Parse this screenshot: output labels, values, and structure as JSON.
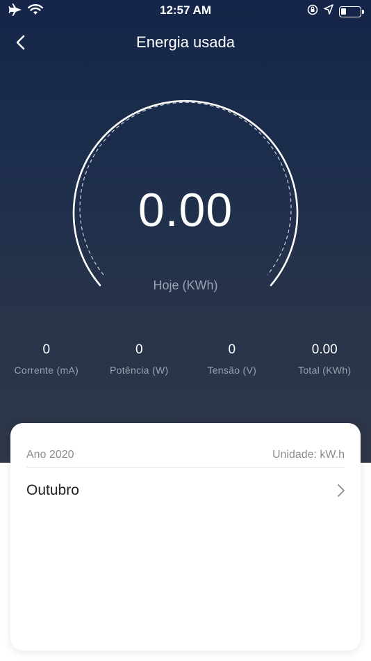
{
  "status_bar": {
    "time": "12:57 AM",
    "icons": [
      "airplane-icon",
      "wifi-icon",
      "orientation-lock-icon",
      "location-icon",
      "battery-icon"
    ]
  },
  "nav": {
    "title": "Energia usada",
    "back_icon": "chevron-left-icon"
  },
  "gauge": {
    "value": "0.00",
    "label": "Hoje (KWh)"
  },
  "stats": [
    {
      "value": "0",
      "label": "Corrente (mA)"
    },
    {
      "value": "0",
      "label": "Potência (W)"
    },
    {
      "value": "0",
      "label": "Tensão (V)"
    },
    {
      "value": "0.00",
      "label": "Total (KWh)"
    }
  ],
  "card": {
    "year": "Ano 2020",
    "unit": "Unidade: kW.h",
    "rows": [
      {
        "label": "Outubro",
        "icon": "chevron-right-icon"
      }
    ]
  },
  "colors": {
    "hero_top": "#142549",
    "hero_bottom": "#2f3747",
    "label_gray": "#9ba3b1",
    "card_bg": "#ffffff"
  }
}
